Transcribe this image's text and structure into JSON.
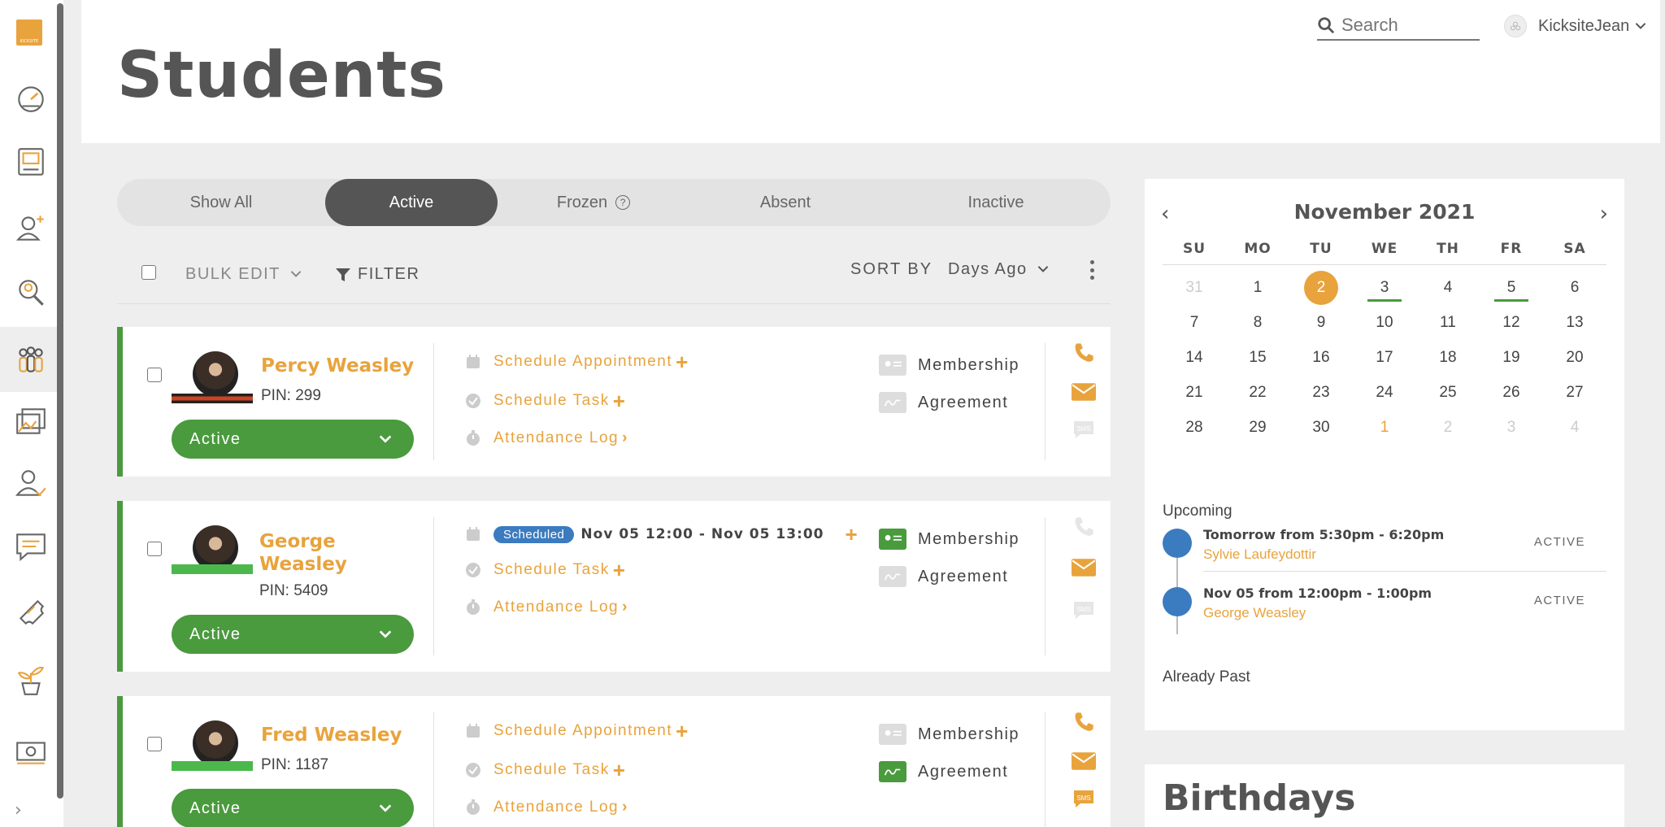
{
  "header": {
    "title": "Students"
  },
  "search": {
    "placeholder": "Search"
  },
  "user": {
    "name": "KicksiteJean"
  },
  "tabs": [
    {
      "label": "Show All",
      "active": false
    },
    {
      "label": "Active",
      "active": true
    },
    {
      "label": "Frozen",
      "active": false
    },
    {
      "label": "Absent",
      "active": false
    },
    {
      "label": "Inactive",
      "active": false
    }
  ],
  "toolbar": {
    "bulk_edit": "BULK EDIT",
    "filter": "FILTER",
    "sort_by": "SORT BY",
    "sort_value": "Days Ago"
  },
  "students": [
    {
      "name": "Percy Weasley",
      "pin": "PIN: 299",
      "status": "Active",
      "schedule_appointment": "Schedule Appointment",
      "schedule_task": "Schedule Task",
      "attendance_log": "Attendance Log",
      "membership": "Membership",
      "agreement": "Agreement"
    },
    {
      "name_line1": "George",
      "name_line2": "Weasley",
      "pin": "PIN: 5409",
      "status": "Active",
      "appointment_badge": "Scheduled",
      "appointment_time": "Nov 05 12:00 - Nov 05 13:00",
      "schedule_task": "Schedule Task",
      "attendance_log": "Attendance Log",
      "membership": "Membership",
      "agreement": "Agreement"
    },
    {
      "name": "Fred Weasley",
      "pin": "PIN: 1187",
      "status": "Active",
      "schedule_appointment": "Schedule Appointment",
      "schedule_task": "Schedule Task",
      "attendance_log": "Attendance Log",
      "membership": "Membership",
      "agreement": "Agreement"
    }
  ],
  "calendar": {
    "month": "November 2021",
    "weekdays": [
      "SU",
      "MO",
      "TU",
      "WE",
      "TH",
      "FR",
      "SA"
    ],
    "weeks": [
      [
        "31",
        "1",
        "2",
        "3",
        "4",
        "5",
        "6"
      ],
      [
        "7",
        "8",
        "9",
        "10",
        "11",
        "12",
        "13"
      ],
      [
        "14",
        "15",
        "16",
        "17",
        "18",
        "19",
        "20"
      ],
      [
        "21",
        "22",
        "23",
        "24",
        "25",
        "26",
        "27"
      ],
      [
        "28",
        "29",
        "30",
        "1",
        "2",
        "3",
        "4"
      ]
    ],
    "today": "2",
    "marked_days": [
      "3",
      "5"
    ]
  },
  "upcoming": {
    "title": "Upcoming",
    "events": [
      {
        "when": "Tomorrow from 5:30pm - 6:20pm",
        "who": "Sylvie Laufeydottir",
        "status": "ACTIVE"
      },
      {
        "when": "Nov 05 from 12:00pm - 1:00pm",
        "who": "George Weasley",
        "status": "ACTIVE"
      }
    ],
    "past_title": "Already Past"
  },
  "birthdays": {
    "title": "Birthdays"
  },
  "colors": {
    "accent": "#e8a33d",
    "active_green": "#4a9a3e",
    "scheduled_blue": "#3b7bbf"
  }
}
